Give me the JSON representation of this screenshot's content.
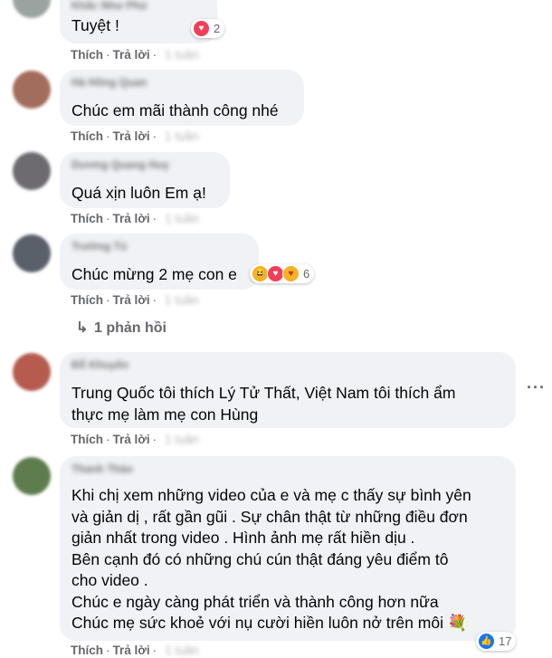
{
  "comments": [
    {
      "author": "Khắc Như Phú",
      "text": "Tuyệt !",
      "reaction": {
        "icons": [
          "love-icon"
        ],
        "count": "2"
      },
      "actions": {
        "like": "Thích",
        "reply": "Trả lời",
        "time": "1 tuần"
      }
    },
    {
      "author": "Hà Hồng Quan",
      "text": "Chúc em mãi thành công nhé",
      "actions": {
        "like": "Thích",
        "reply": "Trả lời",
        "time": "1 tuần"
      }
    },
    {
      "author": "Dương Quang Huy",
      "text": "Quá xịn luôn Em ạ!",
      "actions": {
        "like": "Thích",
        "reply": "Trả lời",
        "time": "1 tuần"
      }
    },
    {
      "author": "Trường Tú",
      "text": "Chúc mừng 2 mẹ con e",
      "reaction": {
        "icons": [
          "haha-icon",
          "love-icon",
          "care-icon"
        ],
        "count": "6"
      },
      "actions": {
        "like": "Thích",
        "reply": "Trả lời",
        "time": "1 tuần"
      },
      "replies_label": "1 phản hồi"
    },
    {
      "author": "Đỗ Khuyên",
      "text": "Trung Quốc tôi thích Lý Tử Thất, Việt Nam tôi thích ẩm\nthực mẹ làm mẹ con Hùng",
      "actions": {
        "like": "Thích",
        "reply": "Trả lời",
        "time": "1 tuần"
      }
    },
    {
      "author": "Thanh Thảo",
      "text": "Khi chị xem những video của e và mẹ c thấy sự bình yên\nvà giản dị , rất gần gũi . Sự chân thật từ những điều đơn\ngiản nhất trong video . Hình ảnh mẹ rất hiền dịu .\nBên cạnh đó có những chú cún thật đáng yêu điểm tô\ncho video .\nChúc e ngày càng phát triển và thành công hơn nữa\nChúc mẹ sức khoẻ với nụ cười hiền luôn nở trên môi 💐",
      "reaction": {
        "icons": [
          "like-icon"
        ],
        "count": "17"
      },
      "actions": {
        "like": "Thích",
        "reply": "Trả lời",
        "time": "1 tuần"
      }
    }
  ],
  "colors": {
    "bubble": "#f0f2f5",
    "secondary_text": "#65676b",
    "love": "#f33e58",
    "like": "#1877f2",
    "haha": "#f7b125"
  }
}
